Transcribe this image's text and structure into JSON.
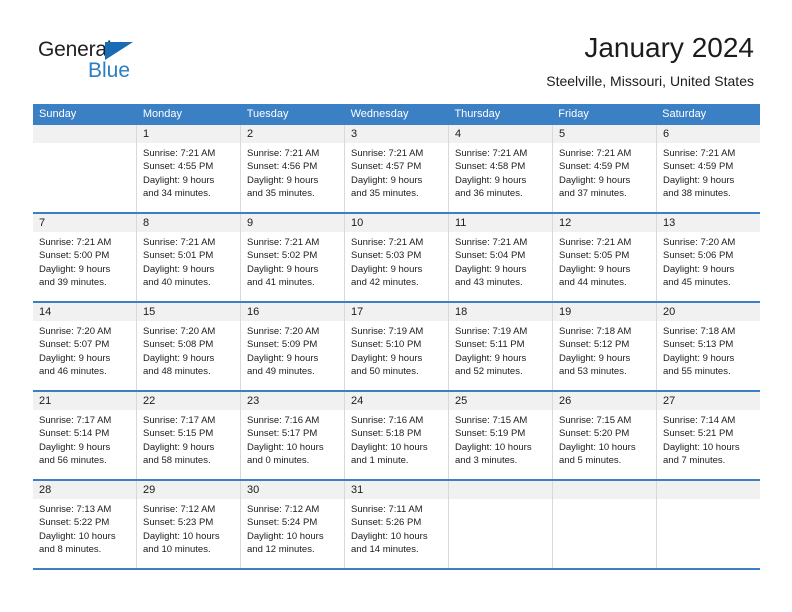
{
  "brand": {
    "name_part1": "General",
    "name_part2": "Blue",
    "accent_color": "#2b7ec1",
    "triangle_color": "#1a6bb5"
  },
  "header": {
    "title": "January 2024",
    "subtitle": "Steelville, Missouri, United States"
  },
  "calendar": {
    "header_color": "#3b7fc4",
    "daynum_band_color": "#f1f1f1",
    "weekdays": [
      "Sunday",
      "Monday",
      "Tuesday",
      "Wednesday",
      "Thursday",
      "Friday",
      "Saturday"
    ],
    "weeks": [
      [
        {
          "day": "",
          "sunrise": "",
          "sunset": "",
          "daylight_line1": "",
          "daylight_line2": ""
        },
        {
          "day": "1",
          "sunrise": "Sunrise: 7:21 AM",
          "sunset": "Sunset: 4:55 PM",
          "daylight_line1": "Daylight: 9 hours",
          "daylight_line2": "and 34 minutes."
        },
        {
          "day": "2",
          "sunrise": "Sunrise: 7:21 AM",
          "sunset": "Sunset: 4:56 PM",
          "daylight_line1": "Daylight: 9 hours",
          "daylight_line2": "and 35 minutes."
        },
        {
          "day": "3",
          "sunrise": "Sunrise: 7:21 AM",
          "sunset": "Sunset: 4:57 PM",
          "daylight_line1": "Daylight: 9 hours",
          "daylight_line2": "and 35 minutes."
        },
        {
          "day": "4",
          "sunrise": "Sunrise: 7:21 AM",
          "sunset": "Sunset: 4:58 PM",
          "daylight_line1": "Daylight: 9 hours",
          "daylight_line2": "and 36 minutes."
        },
        {
          "day": "5",
          "sunrise": "Sunrise: 7:21 AM",
          "sunset": "Sunset: 4:59 PM",
          "daylight_line1": "Daylight: 9 hours",
          "daylight_line2": "and 37 minutes."
        },
        {
          "day": "6",
          "sunrise": "Sunrise: 7:21 AM",
          "sunset": "Sunset: 4:59 PM",
          "daylight_line1": "Daylight: 9 hours",
          "daylight_line2": "and 38 minutes."
        }
      ],
      [
        {
          "day": "7",
          "sunrise": "Sunrise: 7:21 AM",
          "sunset": "Sunset: 5:00 PM",
          "daylight_line1": "Daylight: 9 hours",
          "daylight_line2": "and 39 minutes."
        },
        {
          "day": "8",
          "sunrise": "Sunrise: 7:21 AM",
          "sunset": "Sunset: 5:01 PM",
          "daylight_line1": "Daylight: 9 hours",
          "daylight_line2": "and 40 minutes."
        },
        {
          "day": "9",
          "sunrise": "Sunrise: 7:21 AM",
          "sunset": "Sunset: 5:02 PM",
          "daylight_line1": "Daylight: 9 hours",
          "daylight_line2": "and 41 minutes."
        },
        {
          "day": "10",
          "sunrise": "Sunrise: 7:21 AM",
          "sunset": "Sunset: 5:03 PM",
          "daylight_line1": "Daylight: 9 hours",
          "daylight_line2": "and 42 minutes."
        },
        {
          "day": "11",
          "sunrise": "Sunrise: 7:21 AM",
          "sunset": "Sunset: 5:04 PM",
          "daylight_line1": "Daylight: 9 hours",
          "daylight_line2": "and 43 minutes."
        },
        {
          "day": "12",
          "sunrise": "Sunrise: 7:21 AM",
          "sunset": "Sunset: 5:05 PM",
          "daylight_line1": "Daylight: 9 hours",
          "daylight_line2": "and 44 minutes."
        },
        {
          "day": "13",
          "sunrise": "Sunrise: 7:20 AM",
          "sunset": "Sunset: 5:06 PM",
          "daylight_line1": "Daylight: 9 hours",
          "daylight_line2": "and 45 minutes."
        }
      ],
      [
        {
          "day": "14",
          "sunrise": "Sunrise: 7:20 AM",
          "sunset": "Sunset: 5:07 PM",
          "daylight_line1": "Daylight: 9 hours",
          "daylight_line2": "and 46 minutes."
        },
        {
          "day": "15",
          "sunrise": "Sunrise: 7:20 AM",
          "sunset": "Sunset: 5:08 PM",
          "daylight_line1": "Daylight: 9 hours",
          "daylight_line2": "and 48 minutes."
        },
        {
          "day": "16",
          "sunrise": "Sunrise: 7:20 AM",
          "sunset": "Sunset: 5:09 PM",
          "daylight_line1": "Daylight: 9 hours",
          "daylight_line2": "and 49 minutes."
        },
        {
          "day": "17",
          "sunrise": "Sunrise: 7:19 AM",
          "sunset": "Sunset: 5:10 PM",
          "daylight_line1": "Daylight: 9 hours",
          "daylight_line2": "and 50 minutes."
        },
        {
          "day": "18",
          "sunrise": "Sunrise: 7:19 AM",
          "sunset": "Sunset: 5:11 PM",
          "daylight_line1": "Daylight: 9 hours",
          "daylight_line2": "and 52 minutes."
        },
        {
          "day": "19",
          "sunrise": "Sunrise: 7:18 AM",
          "sunset": "Sunset: 5:12 PM",
          "daylight_line1": "Daylight: 9 hours",
          "daylight_line2": "and 53 minutes."
        },
        {
          "day": "20",
          "sunrise": "Sunrise: 7:18 AM",
          "sunset": "Sunset: 5:13 PM",
          "daylight_line1": "Daylight: 9 hours",
          "daylight_line2": "and 55 minutes."
        }
      ],
      [
        {
          "day": "21",
          "sunrise": "Sunrise: 7:17 AM",
          "sunset": "Sunset: 5:14 PM",
          "daylight_line1": "Daylight: 9 hours",
          "daylight_line2": "and 56 minutes."
        },
        {
          "day": "22",
          "sunrise": "Sunrise: 7:17 AM",
          "sunset": "Sunset: 5:15 PM",
          "daylight_line1": "Daylight: 9 hours",
          "daylight_line2": "and 58 minutes."
        },
        {
          "day": "23",
          "sunrise": "Sunrise: 7:16 AM",
          "sunset": "Sunset: 5:17 PM",
          "daylight_line1": "Daylight: 10 hours",
          "daylight_line2": "and 0 minutes."
        },
        {
          "day": "24",
          "sunrise": "Sunrise: 7:16 AM",
          "sunset": "Sunset: 5:18 PM",
          "daylight_line1": "Daylight: 10 hours",
          "daylight_line2": "and 1 minute."
        },
        {
          "day": "25",
          "sunrise": "Sunrise: 7:15 AM",
          "sunset": "Sunset: 5:19 PM",
          "daylight_line1": "Daylight: 10 hours",
          "daylight_line2": "and 3 minutes."
        },
        {
          "day": "26",
          "sunrise": "Sunrise: 7:15 AM",
          "sunset": "Sunset: 5:20 PM",
          "daylight_line1": "Daylight: 10 hours",
          "daylight_line2": "and 5 minutes."
        },
        {
          "day": "27",
          "sunrise": "Sunrise: 7:14 AM",
          "sunset": "Sunset: 5:21 PM",
          "daylight_line1": "Daylight: 10 hours",
          "daylight_line2": "and 7 minutes."
        }
      ],
      [
        {
          "day": "28",
          "sunrise": "Sunrise: 7:13 AM",
          "sunset": "Sunset: 5:22 PM",
          "daylight_line1": "Daylight: 10 hours",
          "daylight_line2": "and 8 minutes."
        },
        {
          "day": "29",
          "sunrise": "Sunrise: 7:12 AM",
          "sunset": "Sunset: 5:23 PM",
          "daylight_line1": "Daylight: 10 hours",
          "daylight_line2": "and 10 minutes."
        },
        {
          "day": "30",
          "sunrise": "Sunrise: 7:12 AM",
          "sunset": "Sunset: 5:24 PM",
          "daylight_line1": "Daylight: 10 hours",
          "daylight_line2": "and 12 minutes."
        },
        {
          "day": "31",
          "sunrise": "Sunrise: 7:11 AM",
          "sunset": "Sunset: 5:26 PM",
          "daylight_line1": "Daylight: 10 hours",
          "daylight_line2": "and 14 minutes."
        },
        {
          "day": "",
          "sunrise": "",
          "sunset": "",
          "daylight_line1": "",
          "daylight_line2": ""
        },
        {
          "day": "",
          "sunrise": "",
          "sunset": "",
          "daylight_line1": "",
          "daylight_line2": ""
        },
        {
          "day": "",
          "sunrise": "",
          "sunset": "",
          "daylight_line1": "",
          "daylight_line2": ""
        }
      ]
    ]
  }
}
